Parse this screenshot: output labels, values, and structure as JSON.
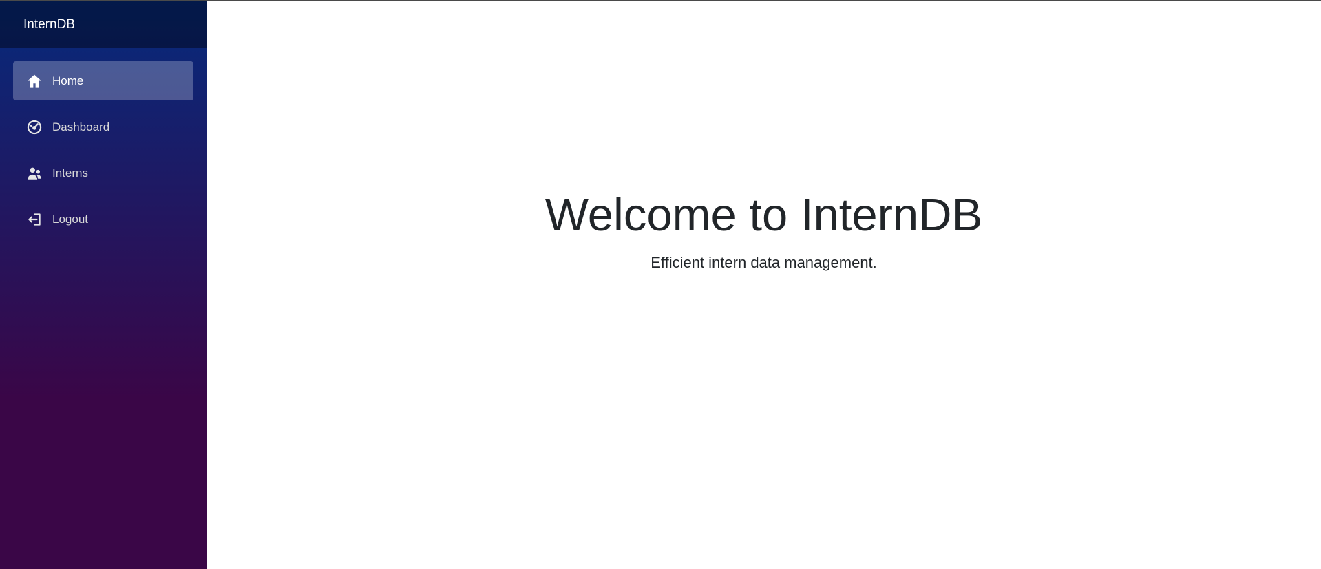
{
  "app": {
    "brand": "InternDB"
  },
  "sidebar": {
    "items": [
      {
        "label": "Home",
        "icon": "home-icon",
        "active": true
      },
      {
        "label": "Dashboard",
        "icon": "dashboard-icon",
        "active": false
      },
      {
        "label": "Interns",
        "icon": "people-icon",
        "active": false
      },
      {
        "label": "Logout",
        "icon": "logout-icon",
        "active": false
      }
    ]
  },
  "main": {
    "title": "Welcome to InternDB",
    "subtitle": "Efficient intern data management."
  },
  "colors": {
    "sidebar_top": "#062a7c",
    "sidebar_bottom": "#3a0647",
    "text": "#212529"
  }
}
